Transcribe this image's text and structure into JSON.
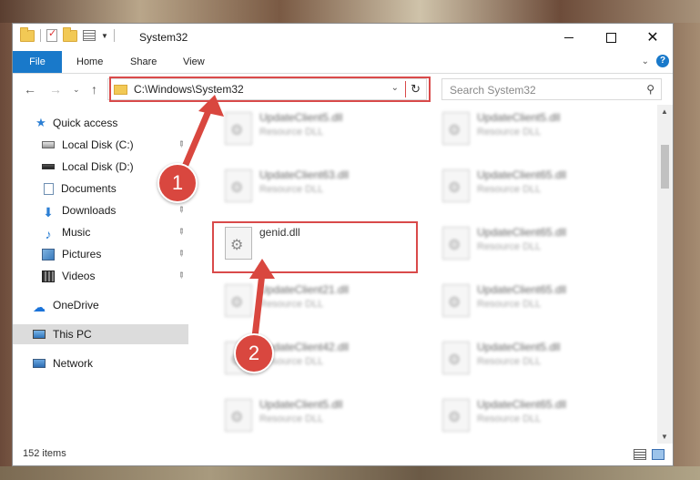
{
  "window": {
    "title": "System32",
    "controls": {
      "minimize_icon": "minimize-icon",
      "maximize_icon": "maximize-icon",
      "close_icon": "close-icon"
    }
  },
  "ribbon": {
    "tabs": [
      {
        "label": "File"
      },
      {
        "label": "Home"
      },
      {
        "label": "Share"
      },
      {
        "label": "View"
      }
    ],
    "help_label": "?"
  },
  "address_bar": {
    "path": "C:\\Windows\\System32"
  },
  "search": {
    "placeholder": "Search System32"
  },
  "sidebar": {
    "items": [
      {
        "label": "Quick access",
        "icon": "star-icon"
      },
      {
        "label": "Local Disk (C:)",
        "icon": "drive-icon",
        "pinned": true
      },
      {
        "label": "Local Disk (D:)",
        "icon": "drive-icon",
        "pinned": false
      },
      {
        "label": "Documents",
        "icon": "document-icon",
        "pinned": true
      },
      {
        "label": "Downloads",
        "icon": "download-icon",
        "pinned": true
      },
      {
        "label": "Music",
        "icon": "music-icon",
        "pinned": true
      },
      {
        "label": "Pictures",
        "icon": "pictures-icon",
        "pinned": true
      },
      {
        "label": "Videos",
        "icon": "videos-icon",
        "pinned": true
      },
      {
        "label": "OneDrive",
        "icon": "cloud-icon"
      },
      {
        "label": "This PC",
        "icon": "computer-icon",
        "selected": true
      },
      {
        "label": "Network",
        "icon": "network-icon"
      }
    ]
  },
  "files": {
    "highlighted": {
      "name": "genid.dll"
    },
    "left_column": [
      {
        "name": "UpdateClient5.dll",
        "type": "Resource DLL"
      },
      {
        "name": "UpdateClient63.dll",
        "type": "Resource DLL"
      },
      {
        "name": "UpdateClient21.dll",
        "type": "Resource DLL"
      },
      {
        "name": "UpdateClient42.dll",
        "type": "Resource DLL"
      },
      {
        "name": "UpdateClient5.dll",
        "type": "Resource DLL"
      }
    ],
    "right_column": [
      {
        "name": "UpdateClient5.dll",
        "type": "Resource DLL"
      },
      {
        "name": "UpdateClient65.dll",
        "type": "Resource DLL"
      },
      {
        "name": "UpdateClient65.dll",
        "type": "Resource DLL"
      },
      {
        "name": "UpdateClient65.dll",
        "type": "Resource DLL"
      },
      {
        "name": "UpdateClient5.dll",
        "type": "Resource DLL"
      },
      {
        "name": "UpdateClient65.dll",
        "type": "Resource DLL"
      }
    ]
  },
  "status_bar": {
    "item_count": "152 items"
  },
  "annotations": {
    "step1": "1",
    "step2": "2",
    "color": "#d9473f"
  }
}
